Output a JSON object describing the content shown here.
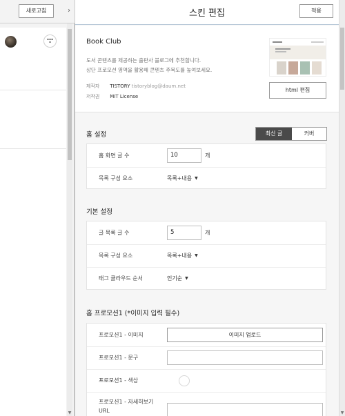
{
  "left": {
    "refresh_label": "새로고침",
    "collapse_icon": "›"
  },
  "header": {
    "title": "스킨 편집",
    "apply_label": "적용"
  },
  "skin": {
    "name": "Book Club",
    "description_line1": "도서 콘텐츠를 제공하는 출판사 블로그에 추천합니다.",
    "description_line2": "상단 프로모션 영역을 활용해 콘텐츠 주목도를 높여보세요.",
    "author_key": "제작자",
    "author_name": "TISTORY",
    "author_email": "tistoryblog@daum.net",
    "copyright_key": "저작권",
    "copyright_value": "MIT License",
    "html_edit_label": "html 편집"
  },
  "home_settings": {
    "title": "홈 설정",
    "tabs": [
      "최신 글",
      "커버"
    ],
    "active_tab": "최신 글",
    "rows": [
      {
        "label": "홈 화면 글 수",
        "value": "10",
        "unit": "개"
      },
      {
        "label": "목록 구성 요소",
        "value": "목록+내용"
      }
    ]
  },
  "basic_settings": {
    "title": "기본 설정",
    "rows": [
      {
        "label": "글 목록 글 수",
        "value": "5",
        "unit": "개"
      },
      {
        "label": "목록 구성 요소",
        "value": "목록+내용"
      },
      {
        "label": "태그 클라우드 순서",
        "value": "인기순"
      }
    ]
  },
  "promotion": {
    "title": "홈 프로모션1 (*이미지 입력 필수)",
    "rows": [
      {
        "label": "프로모션1 - 이미지",
        "button": "이미지 업로드"
      },
      {
        "label": "프로모션1 - 문구",
        "value": ""
      },
      {
        "label": "프로모션1 - 색상"
      },
      {
        "label_line1": "프로모션1 - 자세히보기",
        "label_line2": "URL",
        "value": ""
      }
    ]
  }
}
